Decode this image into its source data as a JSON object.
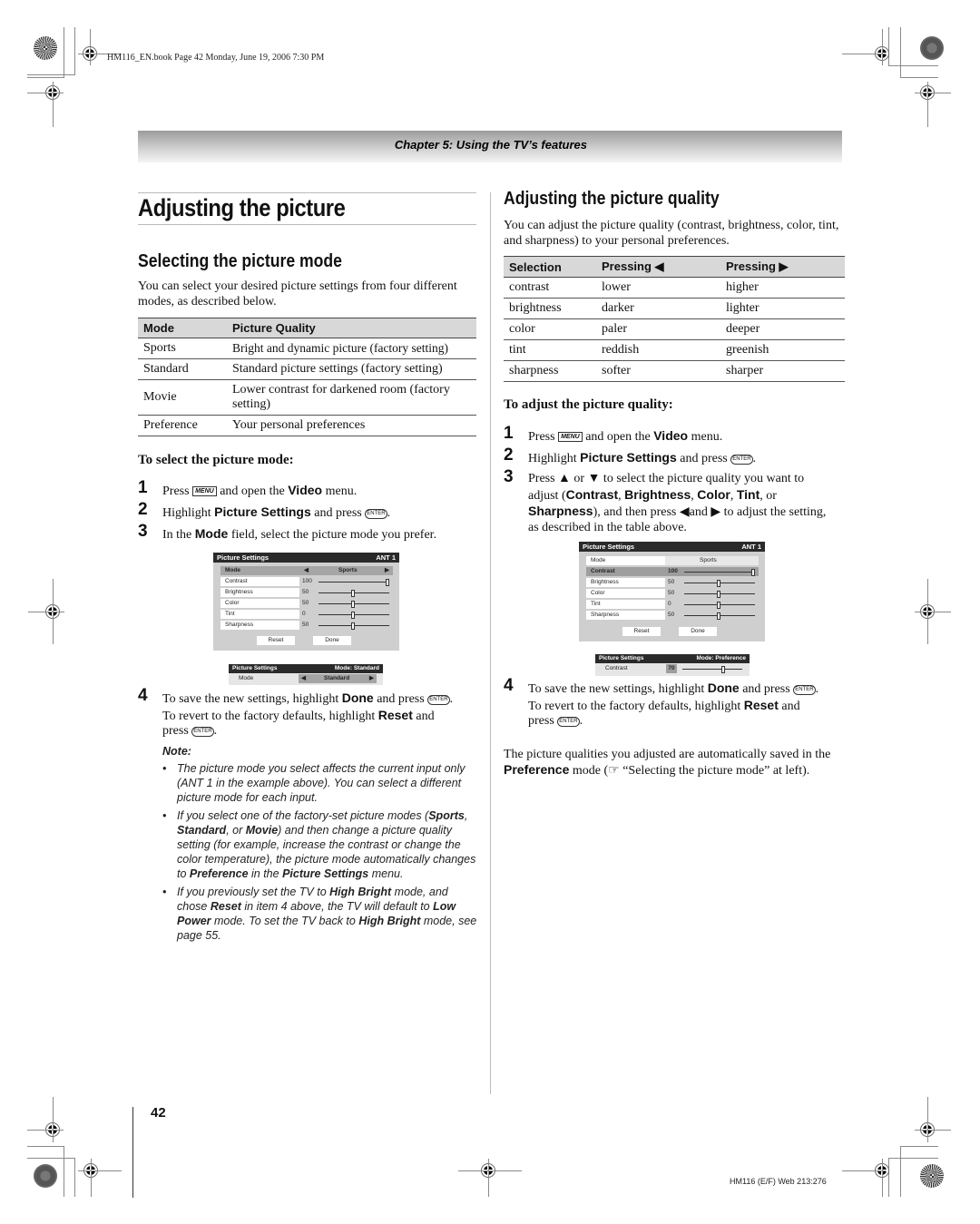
{
  "header_meta": "HM116_EN.book  Page 42  Monday, June 19, 2006  7:30 PM",
  "chapter_title": "Chapter 5: Using the TV’s features",
  "left": {
    "main_title": "Adjusting the picture",
    "section_title": "Selecting the picture mode",
    "intro": "You can select your desired picture settings from four different modes, as described below.",
    "mode_table": {
      "headers": [
        "Mode",
        "Picture Quality"
      ],
      "rows": [
        [
          "Sports",
          "Bright and dynamic picture (factory setting)"
        ],
        [
          "Standard",
          "Standard picture settings (factory setting)"
        ],
        [
          "Movie",
          "Lower contrast for darkened room (factory setting)"
        ],
        [
          "Preference",
          "Your personal preferences"
        ]
      ]
    },
    "procedure_title": "To select the picture mode:",
    "steps": [
      {
        "num": "1",
        "pre": "Press ",
        "icon": "MENU",
        "mid": " and open the ",
        "bold": "Video",
        "post": " menu."
      },
      {
        "num": "2",
        "pre": "Highlight ",
        "bold": "Picture Settings",
        "mid": " and press ",
        "icon": "ENTER",
        "post": "."
      },
      {
        "num": "3",
        "pre": "In the ",
        "bold": "Mode",
        "post": " field, select the picture mode you prefer."
      }
    ],
    "step4": {
      "num": "4",
      "l1_pre": "To save the new settings, highlight ",
      "l1_bold": "Done",
      "l1_post": " and press ",
      "l2_pre": "To revert to the factory defaults, highlight ",
      "l2_bold": "Reset",
      "l2_post": " and",
      "l3_pre": "press ",
      "enter_icon": "ENTER"
    },
    "note_label": "Note:",
    "notes": [
      "The picture mode you select affects the current input only (ANT 1 in the example above). You can select a different picture mode for each input.",
      "If you select one of the factory-set picture modes (Sports, Standard, or Movie) and then change a picture quality setting (for example, increase the contrast or change the color temperature), the picture mode automatically changes to Preference in the Picture Settings menu.",
      "If you previously set the TV to High Bright mode, and chose Reset in item 4 above, the TV will default to Low Power mode. To set the TV back to High Bright mode, see page 55."
    ],
    "osd_main": {
      "title": "Picture Settings",
      "input": "ANT 1",
      "mode_label": "Mode",
      "mode_value": "Sports",
      "settings": [
        {
          "label": "Contrast",
          "value": "100",
          "level": 1.0
        },
        {
          "label": "Brightness",
          "value": "50",
          "level": 0.5
        },
        {
          "label": "Color",
          "value": "50",
          "level": 0.5
        },
        {
          "label": "Tint",
          "value": "0",
          "level": 0.5
        },
        {
          "label": "Sharpness",
          "value": "50",
          "level": 0.5
        }
      ],
      "reset": "Reset",
      "done": "Done"
    },
    "osd_mini": {
      "title": "Picture Settings",
      "status": "Mode: Standard",
      "label": "Mode",
      "value": "Standard"
    }
  },
  "right": {
    "section_title": "Adjusting the picture quality",
    "intro": "You can adjust the picture quality (contrast, brightness, color, tint, and sharpness) to your personal preferences.",
    "quality_table": {
      "headers": [
        "Selection",
        "Pressing ◀",
        "Pressing ▶"
      ],
      "rows": [
        [
          "contrast",
          "lower",
          "higher"
        ],
        [
          "brightness",
          "darker",
          "lighter"
        ],
        [
          "color",
          "paler",
          "deeper"
        ],
        [
          "tint",
          "reddish",
          "greenish"
        ],
        [
          "sharpness",
          "softer",
          "sharper"
        ]
      ]
    },
    "procedure_title": "To adjust the picture quality:",
    "step1": {
      "pre": "Press ",
      "icon": "MENU",
      "mid": " and open the ",
      "bold": "Video",
      "post": " menu."
    },
    "step2": {
      "pre": "Highlight ",
      "bold": "Picture Settings",
      "mid": " and press ",
      "icon": "ENTER",
      "post": "."
    },
    "step3": {
      "l1": "Press ▲ or ▼ to select the picture quality you want to",
      "l2_pre": "adjust (",
      "b1": "Contrast",
      "b2": "Brightness",
      "b3": "Color",
      "b4": "Tint",
      "l2_post": ", or",
      "b5": "Sharpness",
      "l3_post": "), and then press ◀and ▶ to adjust the setting,",
      "l4": "as described in the table above."
    },
    "osd_main": {
      "title": "Picture Settings",
      "input": "ANT 1",
      "mode_label": "Mode",
      "mode_value": "Sports",
      "settings": [
        {
          "label": "Contrast",
          "value": "100",
          "level": 1.0,
          "highlighted": true
        },
        {
          "label": "Brightness",
          "value": "50",
          "level": 0.5
        },
        {
          "label": "Color",
          "value": "50",
          "level": 0.5
        },
        {
          "label": "Tint",
          "value": "0",
          "level": 0.5
        },
        {
          "label": "Sharpness",
          "value": "50",
          "level": 0.5
        }
      ],
      "reset": "Reset",
      "done": "Done"
    },
    "osd_mini": {
      "title": "Picture Settings",
      "status": "Mode: Preference",
      "label": "Contrast",
      "value": "70",
      "level": 0.7
    },
    "step4": {
      "num": "4",
      "l1_pre": "To save the new settings, highlight ",
      "l1_bold": "Done",
      "l1_post": " and press ",
      "l2_pre": "To revert to the factory defaults, highlight ",
      "l2_bold": "Reset",
      "l2_post": " and",
      "l3_pre": "press ",
      "enter_icon": "ENTER"
    },
    "closing_pre": "The picture qualities you adjusted are automatically saved in the ",
    "closing_bold": "Preference",
    "closing_mid": " mode (",
    "closing_ref_icon": "☞",
    "closing_post": " “Selecting the picture mode” at left)."
  },
  "page_number": "42",
  "footer_code": "HM116 (E/F) Web 213:276"
}
